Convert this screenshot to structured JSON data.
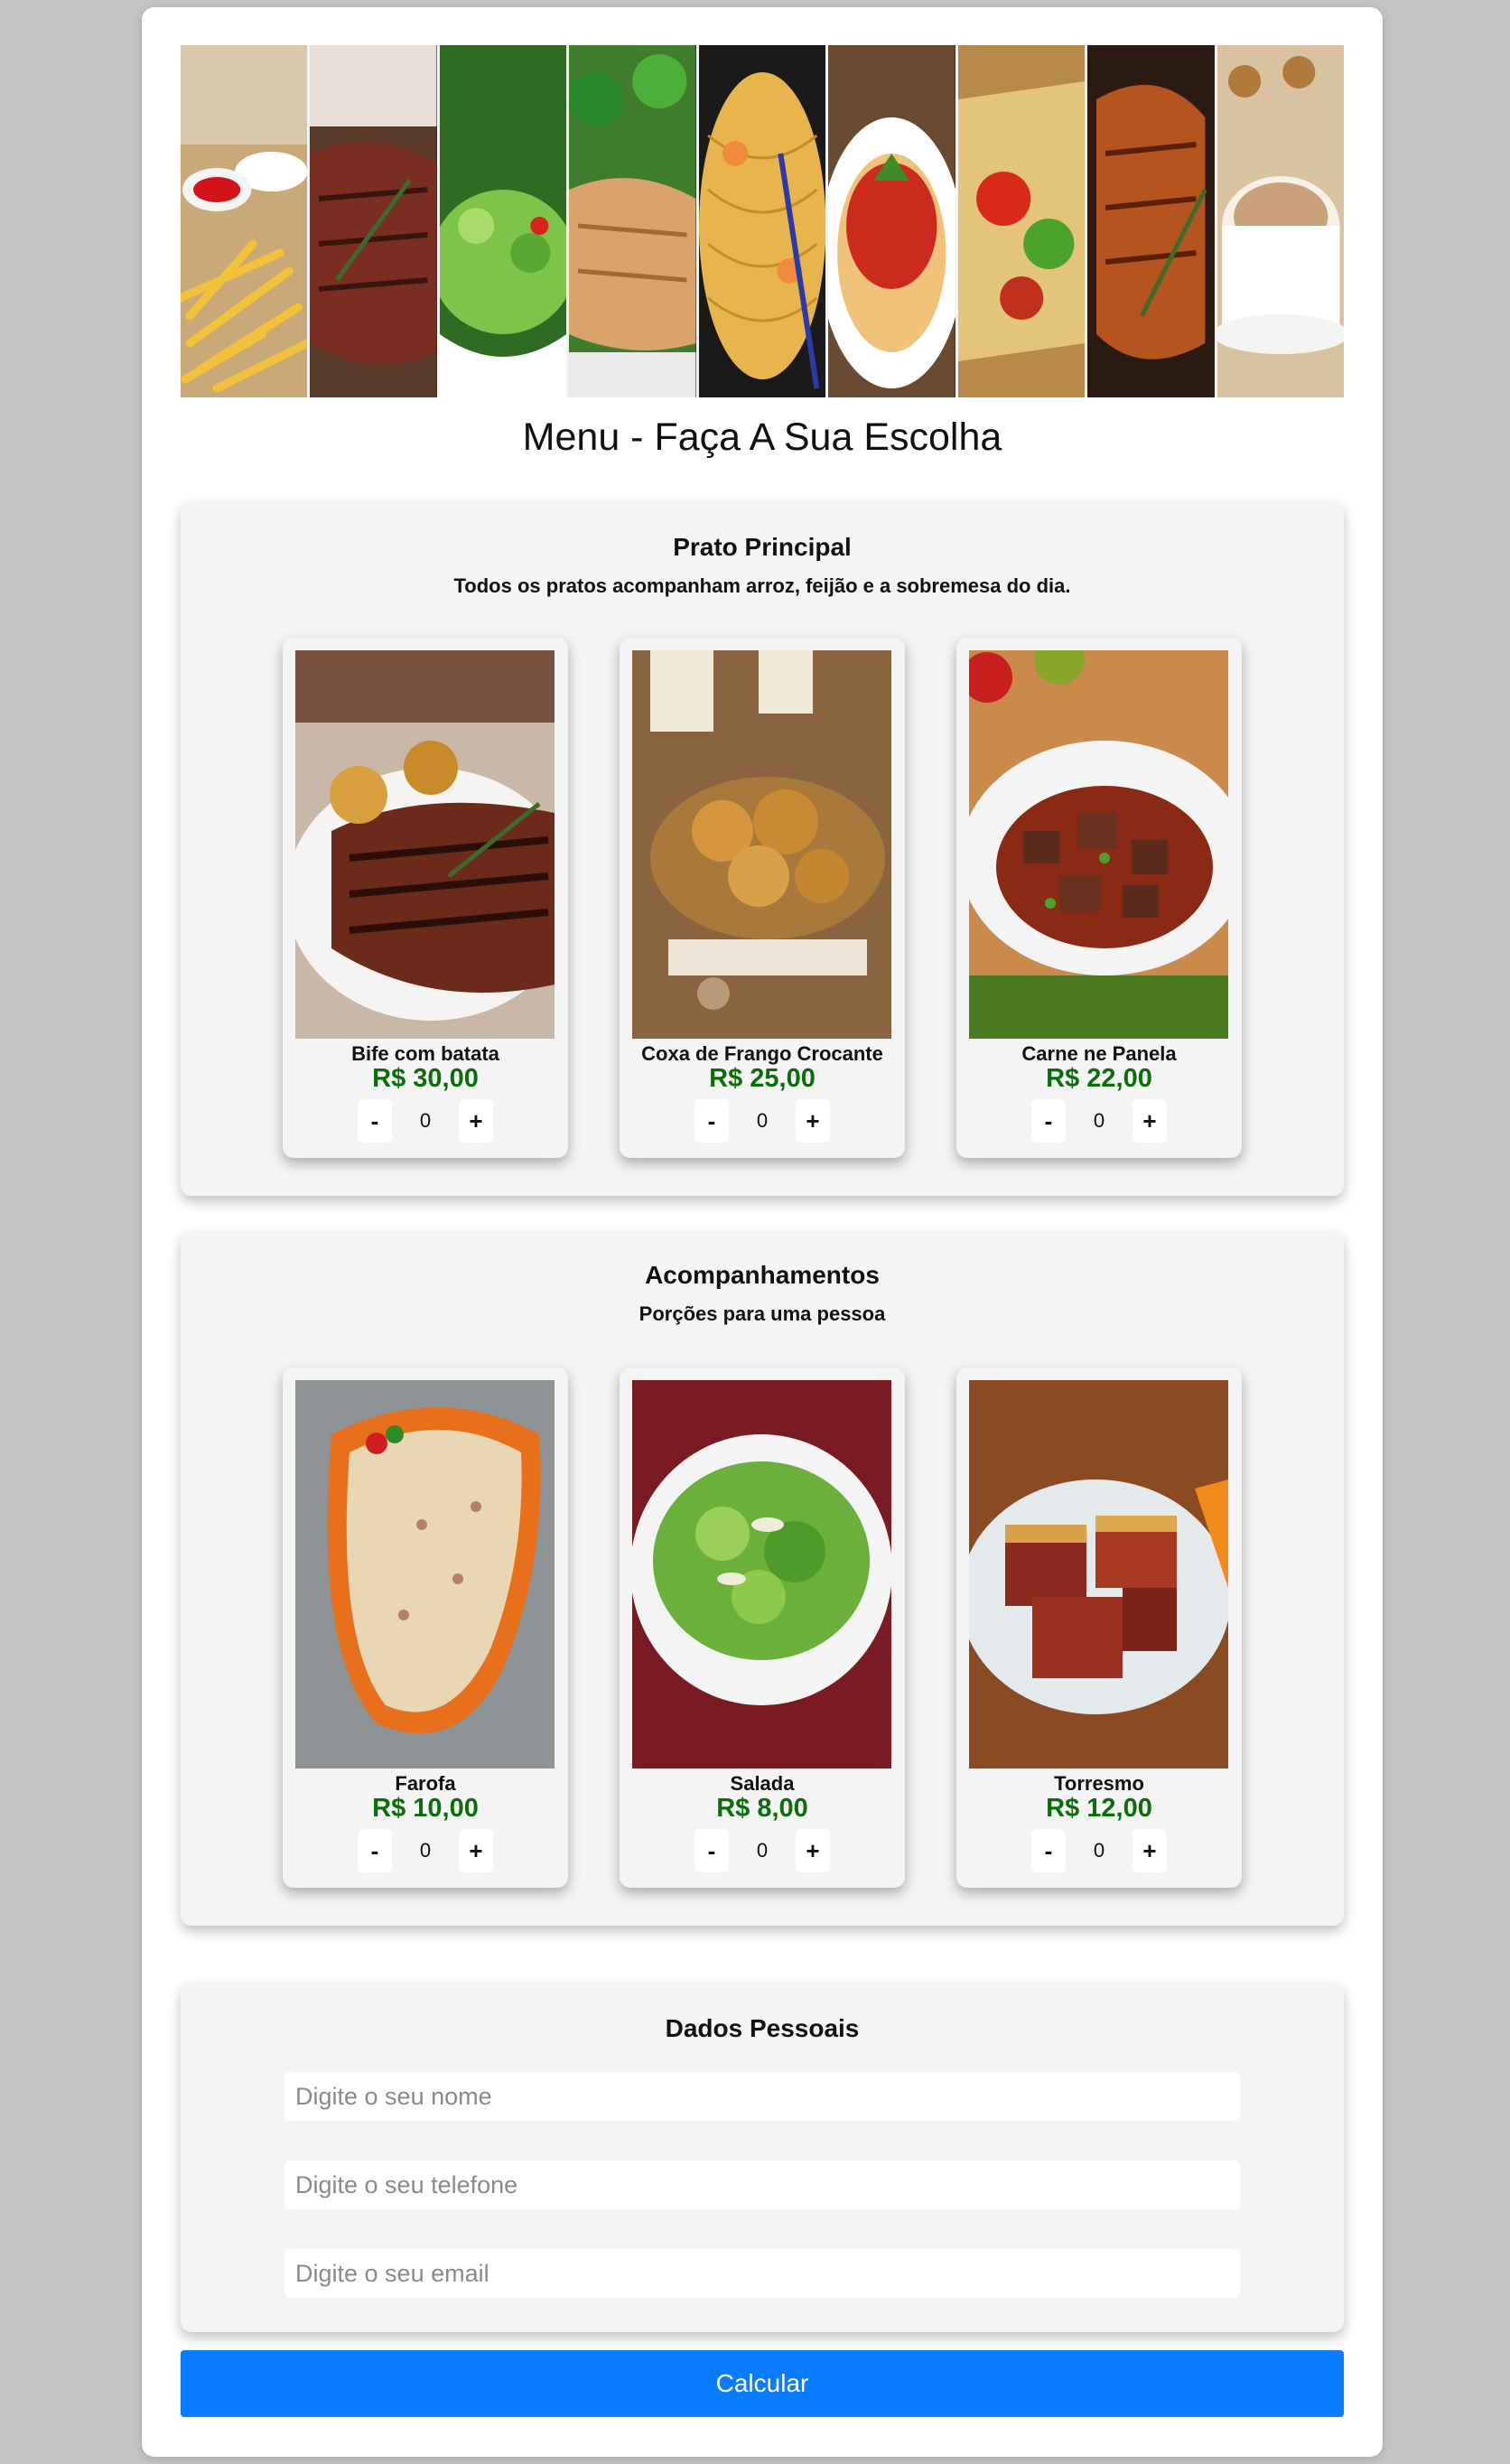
{
  "page_title": "Menu - Faça A Sua Escolha",
  "sections": [
    {
      "title": "Prato Principal",
      "subtitle": "Todos os pratos acompanham arroz, feijão e a sobremesa do dia.",
      "items": [
        {
          "name": "Bife com batata",
          "price": "R$ 30,00",
          "qty": "0"
        },
        {
          "name": "Coxa de Frango Crocante",
          "price": "R$ 25,00",
          "qty": "0"
        },
        {
          "name": "Carne ne Panela",
          "price": "R$ 22,00",
          "qty": "0"
        }
      ]
    },
    {
      "title": "Acompanhamentos",
      "subtitle": "Porções para uma pessoa",
      "items": [
        {
          "name": "Farofa",
          "price": "R$ 10,00",
          "qty": "0"
        },
        {
          "name": "Salada",
          "price": "R$ 8,00",
          "qty": "0"
        },
        {
          "name": "Torresmo",
          "price": "R$ 12,00",
          "qty": "0"
        }
      ]
    }
  ],
  "stepper": {
    "minus": "-",
    "plus": "+"
  },
  "personal": {
    "title": "Dados Pessoais",
    "name_placeholder": "Digite o seu nome",
    "phone_placeholder": "Digite o seu telefone",
    "email_placeholder": "Digite o seu email"
  },
  "calculate_label": "Calcular",
  "colors": {
    "price": "#0b6e0b",
    "button": "#0a7cff",
    "background": "#c4c4c4"
  }
}
